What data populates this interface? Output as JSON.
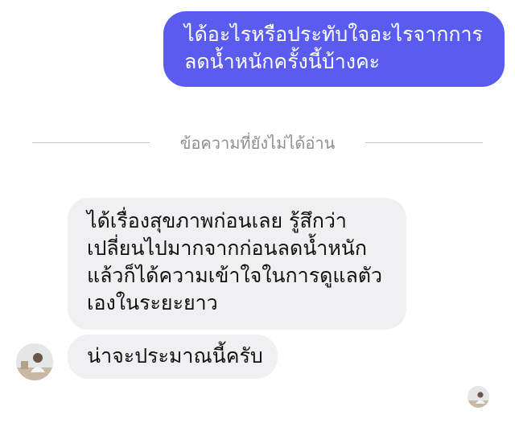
{
  "messages": [
    {
      "direction": "outgoing",
      "text": "ได้อะไรหรือประทับใจอะไรจากการ\nลดน้ำหนักครั้งนี้บ้างคะ"
    },
    {
      "direction": "incoming",
      "text": "ได้เรื่องสุขภาพก่อนเลย รู้สึกว่า\nเปลี่ยนไปมากจากก่อนลดน้ำหนัก\nแล้วก็ได้ความเข้าใจในการดูแลตัว\nเองในระยะยาว"
    },
    {
      "direction": "incoming",
      "text": "น่าจะประมาณนี้ครับ"
    }
  ],
  "divider": {
    "label": "ข้อความที่ยังไม่ได้อ่าน"
  },
  "colors": {
    "outgoing_bubble": "#5a5cf0",
    "incoming_bubble": "#f0f0f2",
    "divider": "#c8c8cc",
    "divider_text": "#8e8e93"
  }
}
